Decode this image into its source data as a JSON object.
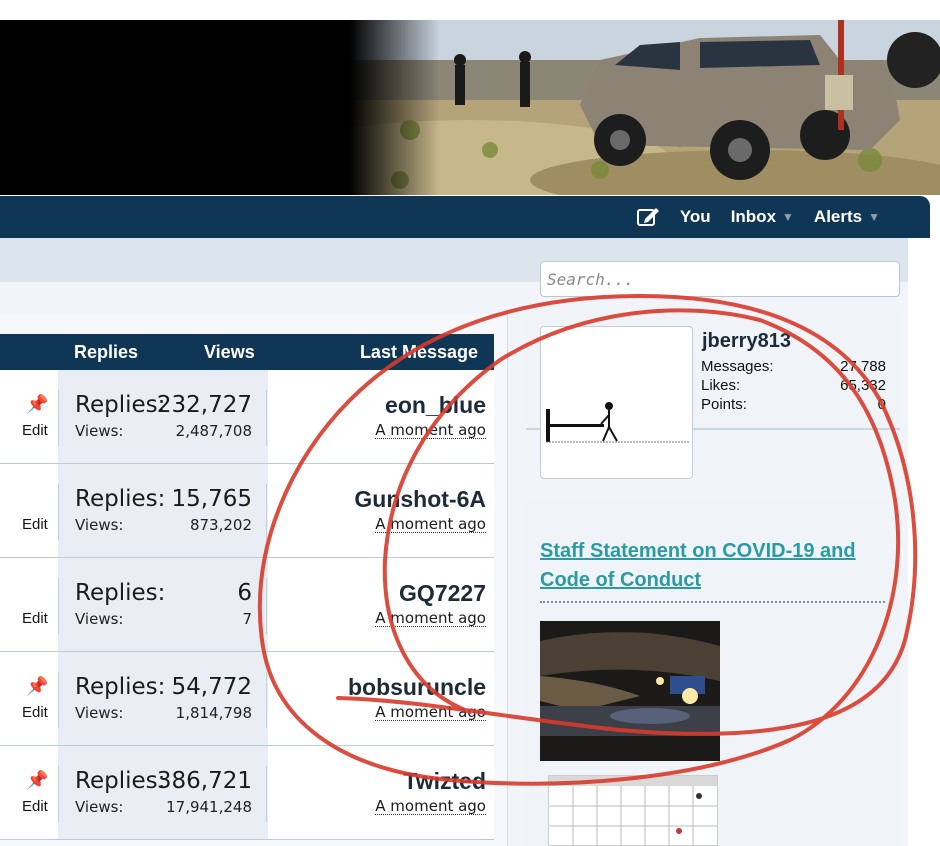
{
  "nav": {
    "compose_icon": "compose-icon",
    "you": "You",
    "inbox": "Inbox",
    "alerts": "Alerts"
  },
  "search": {
    "placeholder": "Search..."
  },
  "thread_table": {
    "headers": {
      "replies": "Replies",
      "views": "Views",
      "last_message": "Last Message"
    },
    "replies_label": "Replies:",
    "views_label": "Views:",
    "edit_label": "Edit",
    "rows": [
      {
        "pinned": true,
        "replies": "232,727",
        "views": "2,487,708",
        "user": "eon_blue",
        "time": "A moment ago"
      },
      {
        "pinned": false,
        "replies": "15,765",
        "views": "873,202",
        "user": "Gunshot-6A",
        "time": "A moment ago"
      },
      {
        "pinned": false,
        "replies": "6",
        "views": "7",
        "user": "GQ7227",
        "time": "A moment ago"
      },
      {
        "pinned": true,
        "replies": "54,772",
        "views": "1,814,798",
        "user": "bobsuruncle",
        "time": "A moment ago"
      },
      {
        "pinned": true,
        "replies": "386,721",
        "views": "17,941,248",
        "user": "Twizted",
        "time": "A moment ago"
      }
    ]
  },
  "sidebar": {
    "username": "jberry813",
    "stats": [
      {
        "label": "Messages:",
        "value": "27,788"
      },
      {
        "label": "Likes:",
        "value": "65,332"
      },
      {
        "label": "Points:",
        "value": "0"
      }
    ],
    "notice_link": "Staff Statement on COVID-19 and Code of Conduct"
  },
  "colors": {
    "navbar": "#0f3654",
    "notice_link": "#2c9aa5",
    "annotation": "#d83a2a"
  }
}
